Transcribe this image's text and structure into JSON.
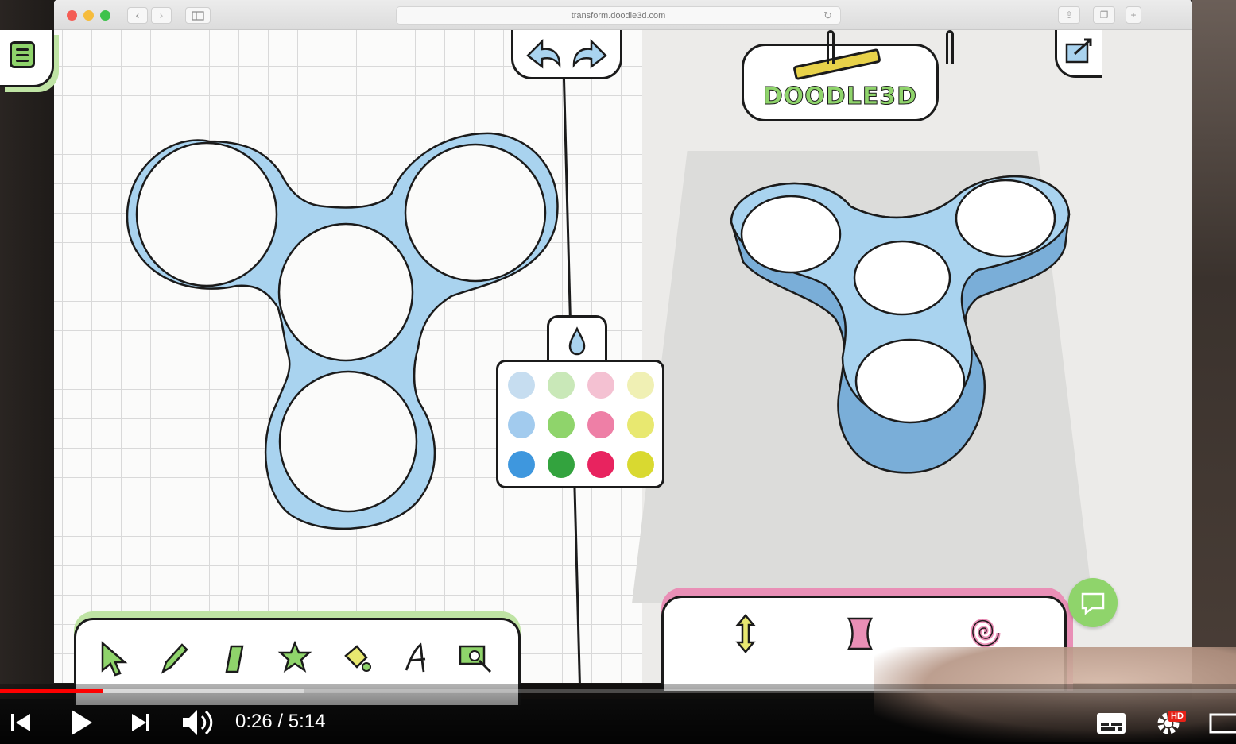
{
  "browser": {
    "url": "transform.doodle3d.com",
    "back_glyph": "‹",
    "forward_glyph": "›"
  },
  "app": {
    "logo_text": "DOODLE3D",
    "colors": {
      "model_blue": "#a9d3ef",
      "outline": "#1b1b1b",
      "accent_green": "#8fd46b",
      "accent_pink": "#e98fb6"
    },
    "tools": [
      "select-arrow-icon",
      "pencil-icon",
      "eraser-icon",
      "star-icon",
      "fill-bucket-icon",
      "text-icon",
      "photo-trace-icon"
    ],
    "shape_tools": [
      "height-arrows-icon",
      "twist-barrel-icon",
      "spiral-icon"
    ],
    "color_palette": [
      [
        "#c6ddf0",
        "#c9e8b8",
        "#f4c1d2",
        "#f0f0b4"
      ],
      [
        "#a2cbee",
        "#8fd46b",
        "#ee7fa6",
        "#e8e870"
      ],
      [
        "#3e97de",
        "#33a33e",
        "#e8235f",
        "#d9d930"
      ]
    ]
  },
  "player": {
    "current_time": "0:26",
    "separator": "/",
    "duration": "5:14",
    "progress_fraction": 0.083,
    "buffered_fraction": 0.246,
    "hd_badge": "HD"
  }
}
